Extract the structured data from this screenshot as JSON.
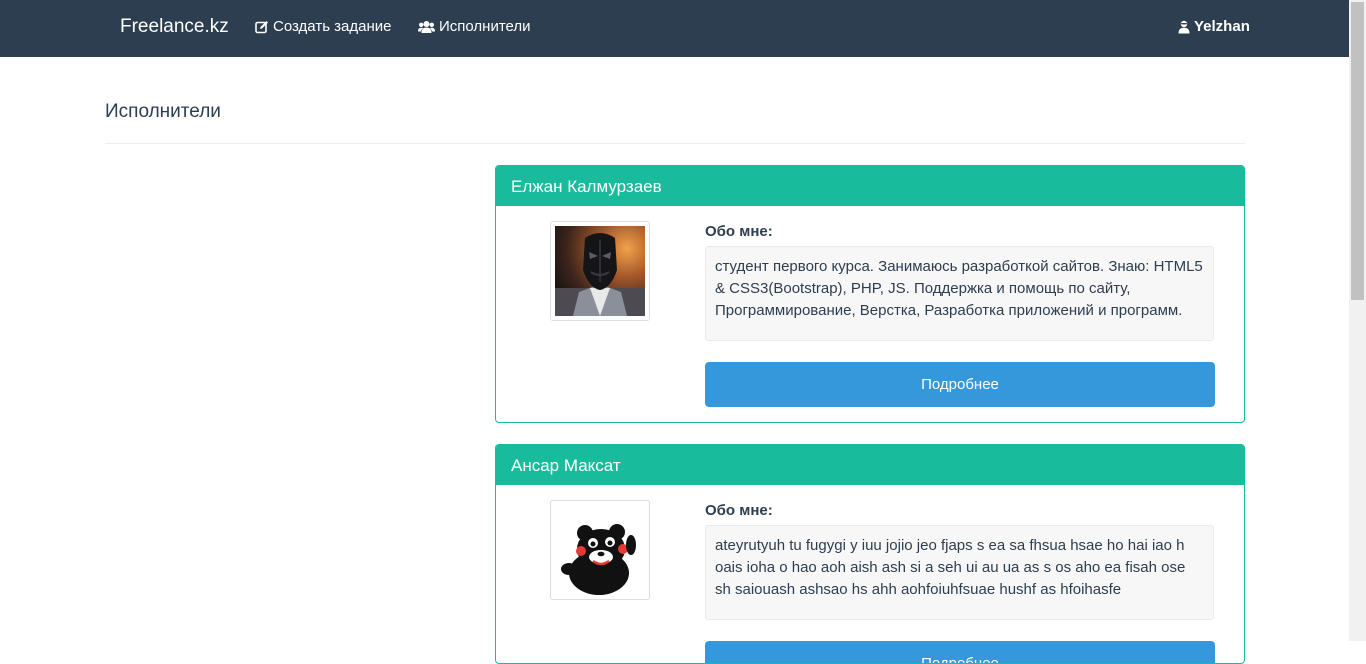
{
  "navbar": {
    "brand": "Freelance.kz",
    "create_task": "Создать задание",
    "performers": "Исполнители",
    "user": "Yelzhan",
    "icons": {
      "create_task": "edit-icon",
      "performers": "users-icon",
      "user": "user-icon"
    }
  },
  "page": {
    "title": "Исполнители"
  },
  "performers": [
    {
      "name": "Елжан Калмурзаев",
      "about_label": "Обо мне:",
      "about": "студент первого курса. Занимаюсь разработкой сайтов. Знаю: HTML5 & CSS3(Bootstrap), PHP, JS. Поддержка и помощь по сайту, Программирование, Верстка, Разработка приложений и программ.",
      "button": "Подробнее"
    },
    {
      "name": "Ансар Максат",
      "about_label": "Обо мне:",
      "about": "ateyrutyuh tu fugygi y iuu jojio jeo fjaps s ea sa fhsua hsae ho hai iao h oais ioha o hao aoh aish ash si a seh ui au ua as s os aho ea fisah ose sh saiouash ashsao hs ahh aohfoiuhfsuae hushf as hfoihasfe",
      "button": "Подробнее"
    }
  ],
  "colors": {
    "navbar_bg": "#2c3e50",
    "card_accent": "#18bc9c",
    "button_bg": "#3498db"
  }
}
